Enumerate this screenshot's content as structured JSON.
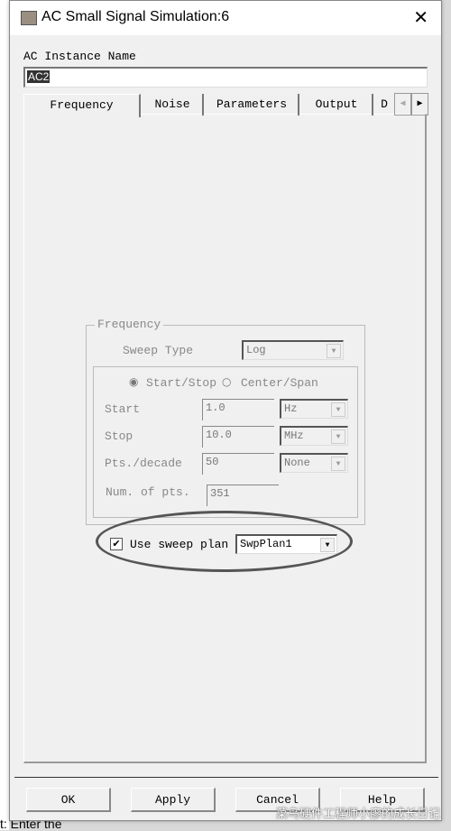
{
  "window": {
    "title": "AC Small Signal Simulation:6",
    "close_icon": "close-icon"
  },
  "instance": {
    "label": "AC Instance Name",
    "value": "AC2"
  },
  "tabs": [
    {
      "label": "Frequency",
      "active": true
    },
    {
      "label": "Noise"
    },
    {
      "label": "Parameters"
    },
    {
      "label": "Output"
    },
    {
      "label": "D"
    }
  ],
  "frequency": {
    "group_label": "Frequency",
    "sweep_type_label": "Sweep Type",
    "sweep_type": "Log",
    "radio_start_stop": "Start/Stop",
    "radio_center_span": "Center/Span",
    "selected_mode": "Start/Stop",
    "start_label": "Start",
    "start_value": "1.0",
    "start_unit": "Hz",
    "stop_label": "Stop",
    "stop_value": "10.0",
    "stop_unit": "MHz",
    "pts_label": "Pts./decade",
    "pts_value": "50",
    "pts_unit": "None",
    "num_label": "Num. of pts.",
    "num_value": "351"
  },
  "sweep_plan": {
    "label": "Use sweep plan",
    "checked": true,
    "value": "SwpPlan1"
  },
  "buttons": {
    "ok": "OK",
    "apply": "Apply",
    "cancel": "Cancel",
    "help": "Help"
  },
  "watermark": "菜鸟硬件工程师小廖的成长日记",
  "background": {
    "status_text": "t: Enter the"
  }
}
